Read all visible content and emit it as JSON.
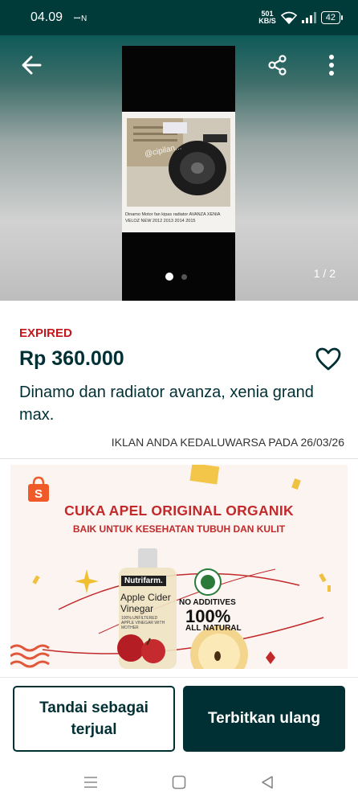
{
  "status_bar": {
    "time": "04.09",
    "nfc": "ꟷ N",
    "net_speed_value": "501",
    "net_speed_unit": "KB/S",
    "battery": "42"
  },
  "gallery": {
    "counter": "1 / 2",
    "active_index": 1,
    "total": 2,
    "photo_watermark": "@cipilan...",
    "photo_caption": "Dinamo Motor fan kipas radiator AVANZA XENIA VELOZ NEW 2012 2013 2014 2015"
  },
  "listing": {
    "status": "EXPIRED",
    "price": "Rp 360.000",
    "title": "Dinamo dan radiator avanza, xenia grand max.",
    "expiry_note": "IKLAN ANDA KEDALUWARSA PADA 26/03/26"
  },
  "banner": {
    "headline": "CUKA APEL ORIGINAL ORGANIK",
    "subheadline": "BAIK UNTUK KESEHATAN TUBUH DAN KULIT",
    "bottle_brand": "Nutrifarm.",
    "bottle_name_line1": "Apple Cider",
    "bottle_name_line2": "Vinegar",
    "bottle_small": "100% UNFILTERED APPLE VINEGAR WITH MOTHER",
    "claim_line1": "NO ADDITIVES",
    "claim_line2": "100%",
    "claim_line3": "ALL NATURAL"
  },
  "actions": {
    "mark_sold": "Tandai sebagai terjual",
    "republish": "Terbitkan ulang"
  },
  "colors": {
    "brand_dark": "#002f34",
    "status_bar": "#003b3a",
    "expired_red": "#c5161d",
    "banner_red": "#c2292b"
  }
}
